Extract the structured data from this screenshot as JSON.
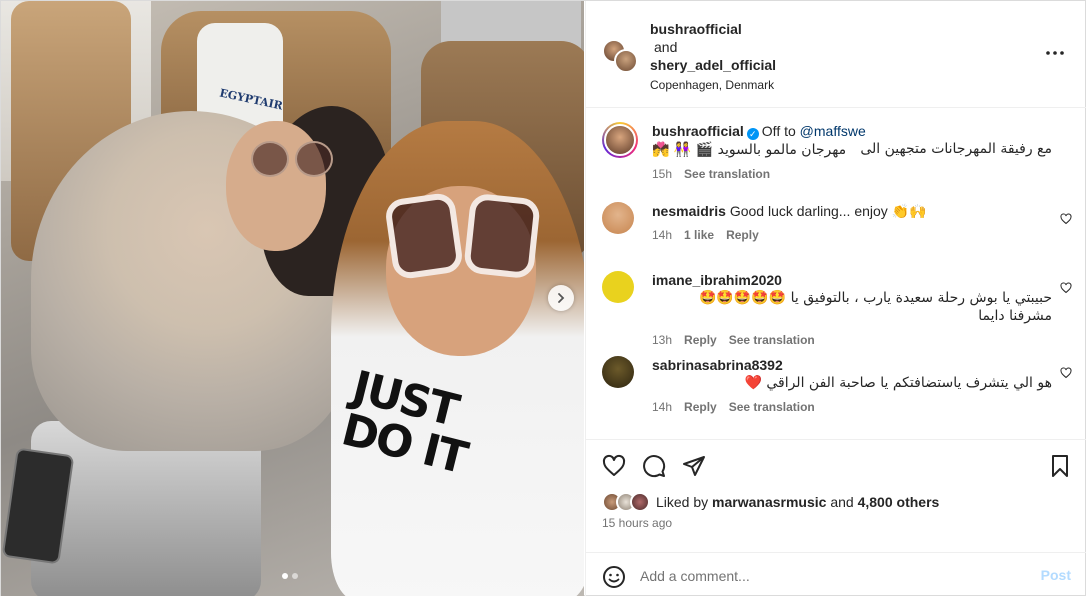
{
  "post": {
    "header": {
      "user1": "bushraofficial",
      "and_text": "and",
      "user2": "shery_adel_official",
      "location": "Copenhagen, Denmark"
    },
    "photo": {
      "shirt_text": "JUST DO IT",
      "headrest_text": "EGYPTAIR",
      "carousel_total": 2,
      "carousel_active": 1
    },
    "caption": {
      "user": "bushraofficial",
      "text_prefix": "Off to",
      "mention": "@maffswe",
      "text_rtl": "مع رفيقة المهرجانات متجهين الى",
      "line2": "مهرجان مالمو بالسويد 🎬 👭 💏",
      "time": "15h",
      "see_translation": "See translation"
    },
    "comments": [
      {
        "user": "nesmaidris",
        "text": "Good luck darling... enjoy 👏🙌",
        "time": "14h",
        "likes": "1 like",
        "reply": "Reply",
        "see_translation": ""
      },
      {
        "user": "imane_ibrahim2020",
        "text": "حبيبتي يا بوش رحلة سعيدة يارب ، بالتوفيق يا 🤩🤩🤩🤩🤩 مشرفنا دايما",
        "time": "13h",
        "likes": "",
        "reply": "Reply",
        "see_translation": "See translation"
      },
      {
        "user": "sabrinasabrina8392",
        "text": "هو الي يتشرف ياستضافتكم يا صاحبة الفن الراقي ❤️",
        "time": "14h",
        "likes": "",
        "reply": "Reply",
        "see_translation": "See translation"
      }
    ],
    "likes": {
      "prefix": "Liked by",
      "user": "marwanasrmusic",
      "middle": "and",
      "count": "4,800 others"
    },
    "time_ago": "15 hours ago",
    "add_comment": {
      "placeholder": "Add a comment...",
      "post_label": "Post"
    }
  },
  "icons": {
    "more": "more-horizontal-icon",
    "like": "heart-icon",
    "comment": "comment-icon",
    "share": "share-icon",
    "save": "bookmark-icon",
    "emoji": "emoji-icon",
    "next": "chevron-right-icon",
    "verified": "verified-badge-icon"
  },
  "colors": {
    "accent": "#0095f6",
    "text": "#262626",
    "secondary": "#737373",
    "post_disabled": "#b3dbff"
  }
}
